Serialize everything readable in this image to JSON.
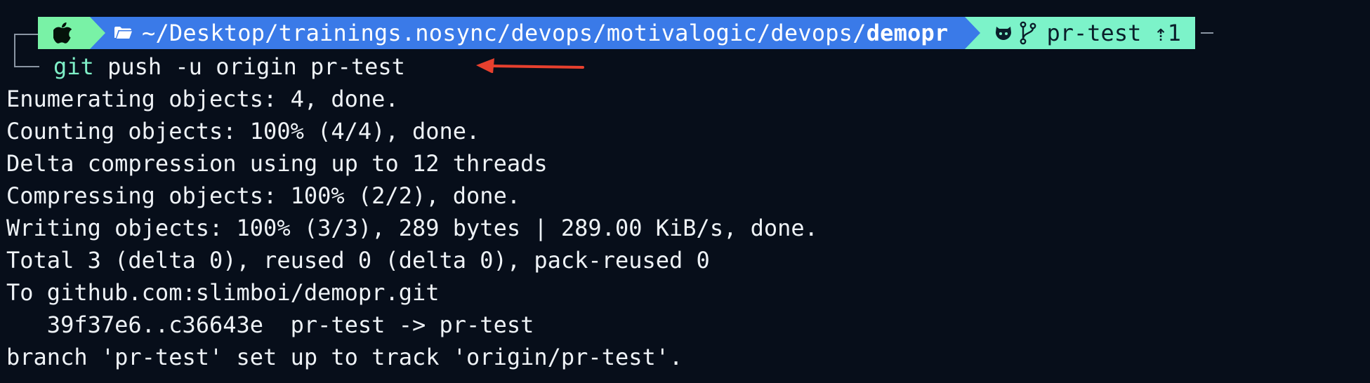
{
  "prompt": {
    "os_icon": "apple-icon",
    "folder_icon": "folder-icon",
    "path_prefix": "~/Desktop/trainings.nosync/devops/motivalogic/devops/",
    "path_current": "demopr",
    "repo_icon": "github-icon",
    "branch_icon": "git-branch-icon",
    "branch": "pr-test",
    "ahead": "⇡1"
  },
  "command": {
    "program": "git",
    "args": " push -u origin pr-test"
  },
  "output": [
    "Enumerating objects: 4, done.",
    "Counting objects: 100% (4/4), done.",
    "Delta compression using up to 12 threads",
    "Compressing objects: 100% (2/2), done.",
    "Writing objects: 100% (3/3), 289 bytes | 289.00 KiB/s, done.",
    "Total 3 (delta 0), reused 0 (delta 0), pack-reused 0",
    "To github.com:slimboi/demopr.git",
    "   39f37e6..c36643e  pr-test -> pr-test",
    "branch 'pr-test' set up to track 'origin/pr-test'."
  ],
  "colors": {
    "background": "#070e1a",
    "segment_os": "#79f2a6",
    "segment_path": "#3a7ae8",
    "segment_git": "#7cf3c9",
    "command_git": "#7ff0c8",
    "annotation_arrow": "#e8402e"
  }
}
